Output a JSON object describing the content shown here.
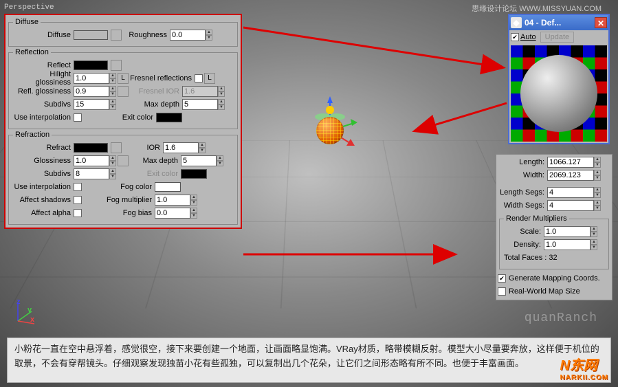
{
  "viewport_label": "Perspective",
  "watermark": "思缘设计论坛  WWW.MISSYUAN.COM",
  "material_panel": {
    "diffuse": {
      "legend": "Diffuse",
      "diffuse_label": "Diffuse",
      "roughness_label": "Roughness",
      "roughness_value": "0.0"
    },
    "reflection": {
      "legend": "Reflection",
      "reflect_label": "Reflect",
      "hilight_gloss_label": "Hilight glossiness",
      "hilight_gloss_value": "1.0",
      "l_btn": "L",
      "refl_gloss_label": "Refl. glossiness",
      "refl_gloss_value": "0.9",
      "fresnel_label": "Fresnel reflections",
      "subdivs_label": "Subdivs",
      "subdivs_value": "15",
      "fresnel_ior_label": "Fresnel IOR",
      "fresnel_ior_value": "1.6",
      "use_interp_label": "Use interpolation",
      "max_depth_label": "Max depth",
      "max_depth_value": "5",
      "exit_color_label": "Exit color"
    },
    "refraction": {
      "legend": "Refraction",
      "refract_label": "Refract",
      "ior_label": "IOR",
      "ior_value": "1.6",
      "gloss_label": "Glossiness",
      "gloss_value": "1.0",
      "max_depth_label": "Max depth",
      "max_depth_value": "5",
      "subdivs_label": "Subdivs",
      "subdivs_value": "8",
      "exit_color_label": "Exit color",
      "use_interp_label": "Use interpolation",
      "fog_color_label": "Fog color",
      "affect_shadows_label": "Affect shadows",
      "fog_mult_label": "Fog multiplier",
      "fog_mult_value": "1.0",
      "affect_alpha_label": "Affect alpha",
      "fog_bias_label": "Fog bias",
      "fog_bias_value": "0.0"
    }
  },
  "matwin": {
    "title": "04 - Def...",
    "auto_label": "Auto",
    "update_label": "Update"
  },
  "plane_params": {
    "length_label": "Length:",
    "length_value": "1066.127",
    "width_label": "Width:",
    "width_value": "2069.123",
    "length_segs_label": "Length Segs:",
    "length_segs_value": "4",
    "width_segs_label": "Width Segs:",
    "width_segs_value": "4",
    "render_mult_legend": "Render Multipliers",
    "scale_label": "Scale:",
    "scale_value": "1.0",
    "density_label": "Density:",
    "density_value": "1.0",
    "total_faces_label": "Total Faces : 32",
    "gen_map_label": "Generate Mapping Coords.",
    "real_world_label": "Real-World Map Size"
  },
  "caption": "小粉花一直在空中悬浮着，感觉很空，接下来要创建一个地面，让画面略显饱满。VRay材质，略带模糊反射。模型大小尽量要奔放，这样便于机位的取景，不会有穿帮镜头。仔细观察发现独苗小花有些孤独，可以复制出几个花朵，让它们之间形态略有所不同。也便于丰富画面。",
  "watermark2": "quanRanch",
  "logo_main": "N东网",
  "logo_sub": "NARKII.COM"
}
